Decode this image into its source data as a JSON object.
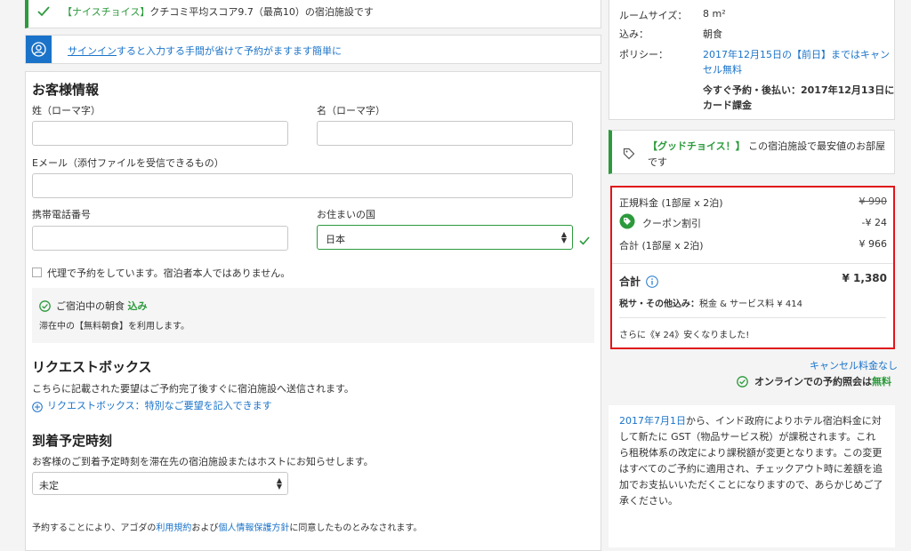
{
  "top_banner": {
    "badge": "【ナイスチョイス】",
    "text": "クチコミ平均スコア",
    "score": "9.7",
    "suffix": "（最高10）の宿泊施設です"
  },
  "signin_banner": {
    "link": "サインイン",
    "text": "すると入力する手間が省けて予約がますます簡単に"
  },
  "guest_form": {
    "title": "お客様情報",
    "last_name_label": "姓（ローマ字）",
    "first_name_label": "名（ローマ字）",
    "email_label": "Eメール（添付ファイルを受信できるもの）",
    "phone_label": "携帯電話番号",
    "country_label": "お住まいの国",
    "country_value": "日本",
    "proxy_checkbox_label": "代理で予約をしています。宿泊者本人ではありません。",
    "breakfast_title": "ご宿泊中の朝食",
    "breakfast_included": "込み",
    "breakfast_note": "滞在中の【無料朝食】を利用します。"
  },
  "request_box": {
    "title": "リクエストボックス",
    "description": "こちらに記載された要望はご予約完了後すぐに宿泊施設へ送信されます。",
    "add_link": "リクエストボックス：特別なご要望を記入できます"
  },
  "arrival": {
    "title": "到着予定時刻",
    "description": "お客様のご到着予定時刻を滞在先の宿泊施設またはホストにお知らせします。",
    "select_value": "未定"
  },
  "terms": {
    "prefix": "予約することにより、アゴダの",
    "terms_link": "利用規約",
    "middle": "および",
    "privacy_link": "個人情報保護方針",
    "suffix": "に同意したものとみなされます。"
  },
  "room_details": {
    "room_size_label": "ルームサイズ：",
    "room_size_value": "8 m²",
    "included_label": "込み：",
    "included_value": "朝食",
    "policy_label": "ポリシー：",
    "policy_line1": "2017年12月15日の【前日】まではキャン",
    "policy_line2": "セル無料",
    "pay_line1": "今すぐ予約・後払い：2017年12月13日に",
    "pay_line2": "カード課金"
  },
  "good_choice": {
    "badge": "【グッドチョイス！】",
    "text": "この宿泊施設で最安値のお部屋",
    "text2": "です"
  },
  "price_box": {
    "regular_label": "正規料金 (1部屋 x 2泊)",
    "regular_value": "¥ 990",
    "coupon_label": "クーポン割引",
    "coupon_value": "-¥ 24",
    "subtotal_label": "合計 (1部屋 x 2泊)",
    "subtotal_value": "¥ 966",
    "total_label": "合計",
    "total_value": "¥ 1,380",
    "tax_label": "税サ・その他込み：",
    "tax_value": "税金 & サービス料 ¥ 414",
    "savings_note": "さらに《¥ 24》安くなりました!"
  },
  "cancel_free": "キャンセル料金なし",
  "online_check": {
    "text": "オンラインでの予約照会は",
    "free": "無料"
  },
  "gst_notice": {
    "date_link": "2017年7月1日",
    "line1_rest": "から、インド政府によりホテル宿泊料金に対",
    "line2": "して新たに GST（物品サービス税）が課税されます。これ",
    "line3": "ら租税体系の改定により課税額が変更となります。この変更",
    "line4": "はすべてのご予約に適用され、チェックアウト時に差額を追",
    "line5": "加でお支払いいただくことになりますので、あらかじめご了",
    "line6": "承ください。"
  },
  "colors": {
    "accent_blue": "#1a73c9",
    "success_green": "#2c9a3c",
    "highlight_red": "#e0151b"
  }
}
